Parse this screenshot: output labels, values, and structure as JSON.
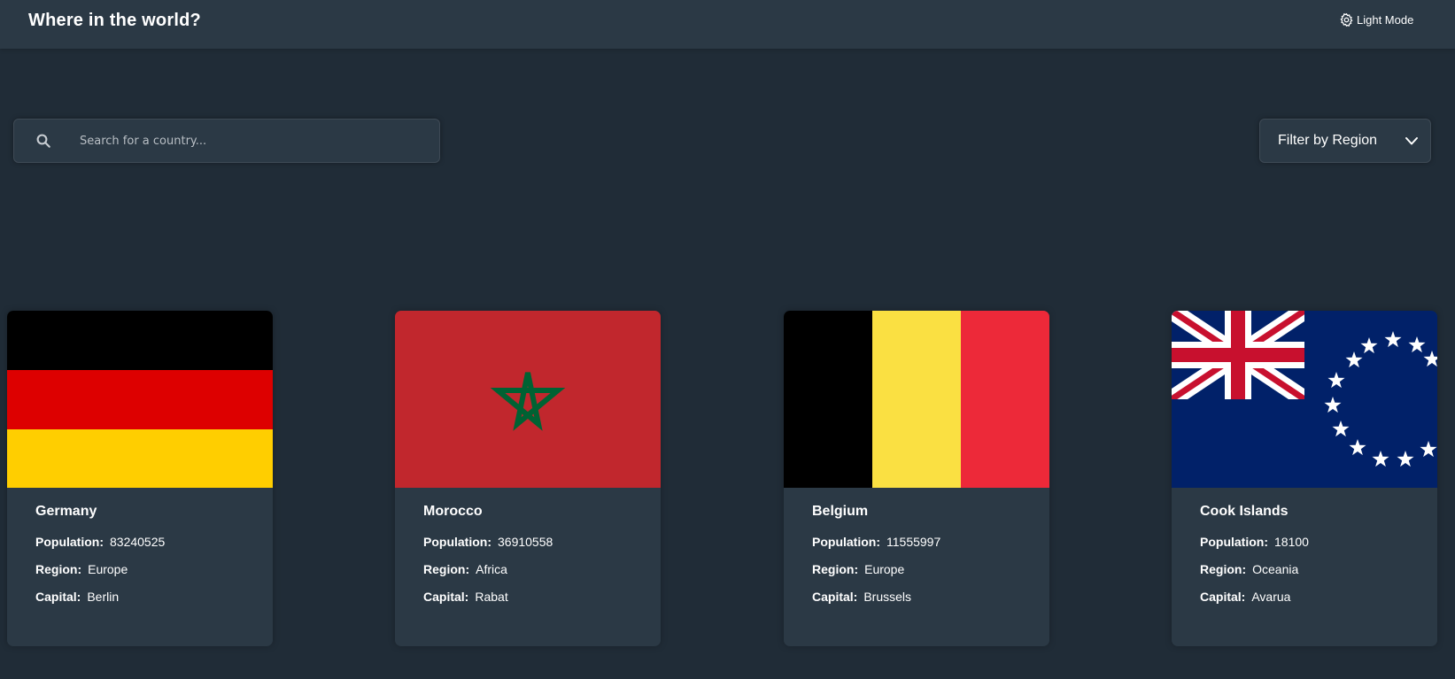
{
  "header": {
    "title": "Where in the world?",
    "mode_label": "Light Mode",
    "mode_icon": "gear-icon"
  },
  "search": {
    "placeholder": "Search for a country...",
    "value": "",
    "icon": "search-icon"
  },
  "filter": {
    "label": "Filter by Region",
    "icon": "chevron-down-icon"
  },
  "labels": {
    "population": "Population:",
    "region": "Region:",
    "capital": "Capital:"
  },
  "colors": {
    "background": "#202c37",
    "element": "#2b3945",
    "text": "#ffffff"
  },
  "countries": [
    {
      "name": "Germany",
      "population": "83240525",
      "region": "Europe",
      "capital": "Berlin",
      "flag": "germany-flag"
    },
    {
      "name": "Morocco",
      "population": "36910558",
      "region": "Africa",
      "capital": "Rabat",
      "flag": "morocco-flag"
    },
    {
      "name": "Belgium",
      "population": "11555997",
      "region": "Europe",
      "capital": "Brussels",
      "flag": "belgium-flag"
    },
    {
      "name": "Cook Islands",
      "population": "18100",
      "region": "Oceania",
      "capital": "Avarua",
      "flag": "cook-islands-flag"
    }
  ]
}
